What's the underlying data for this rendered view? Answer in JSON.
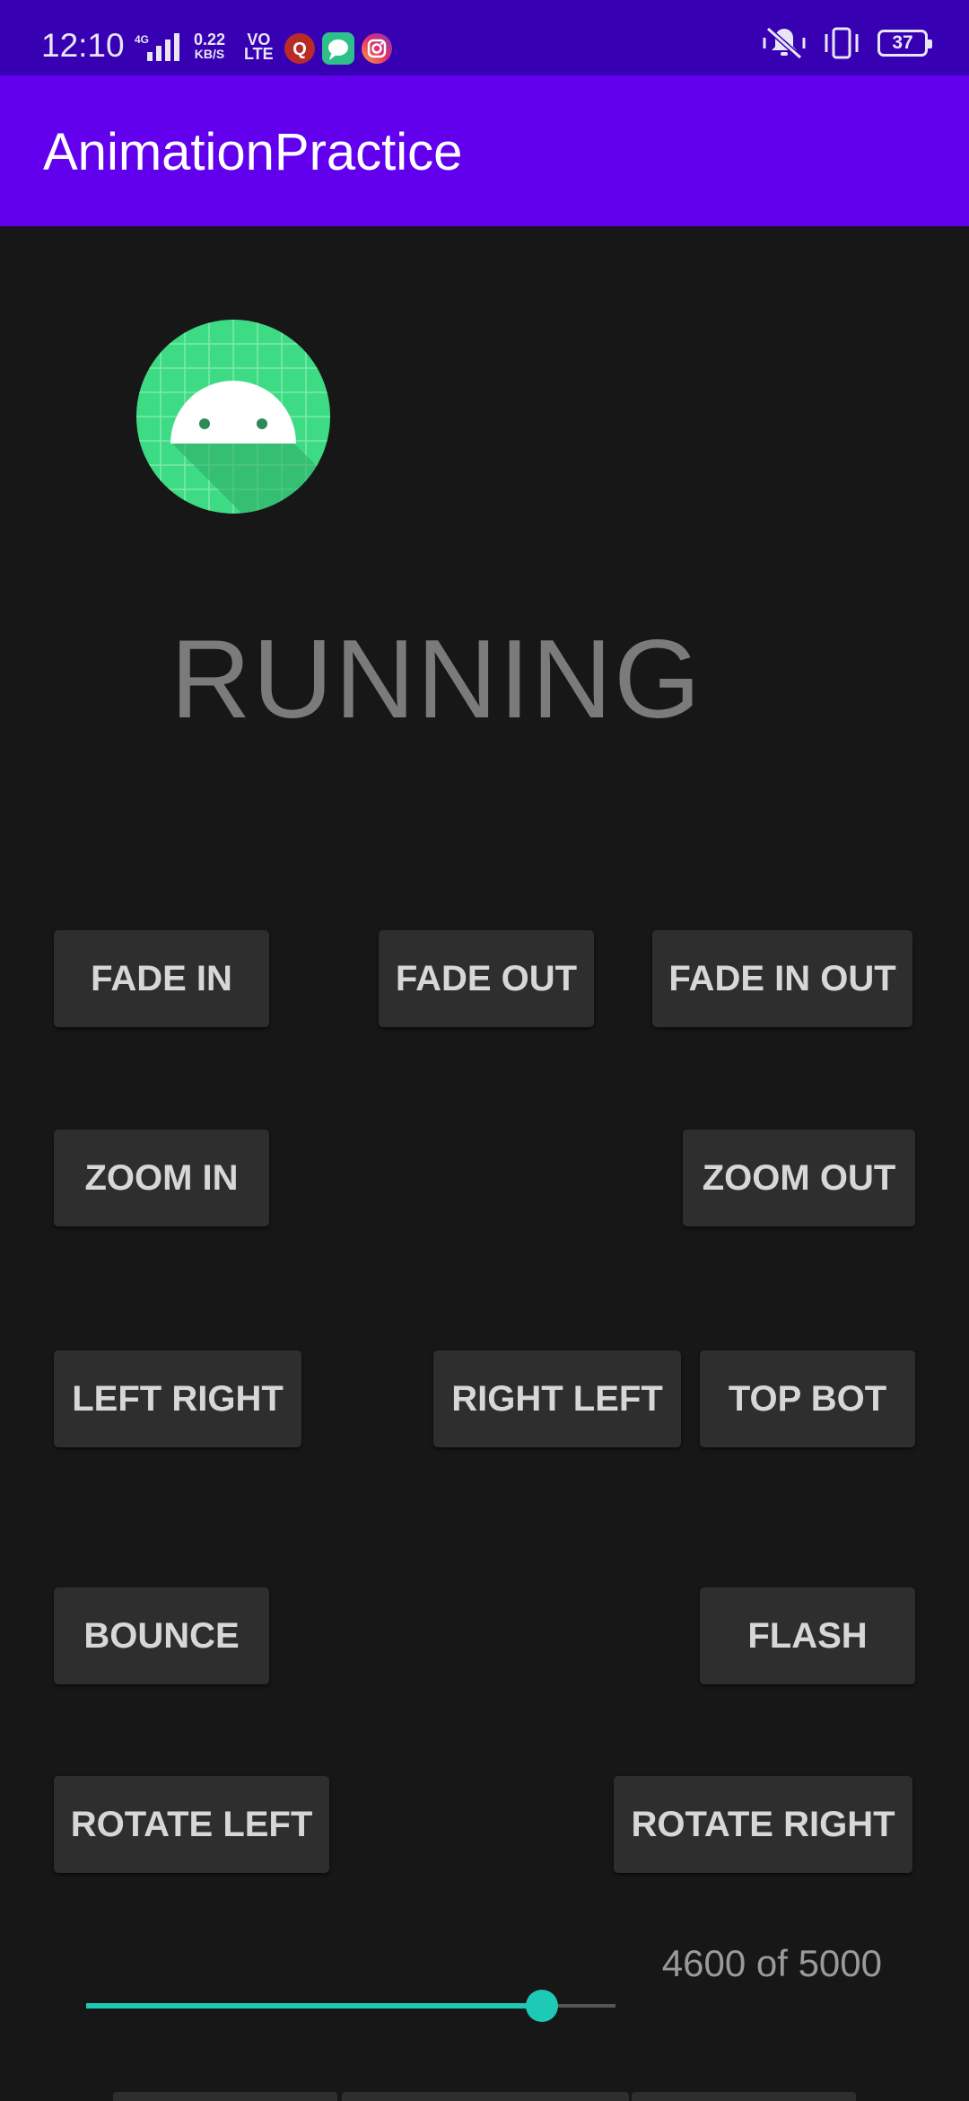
{
  "status_bar": {
    "time": "12:10",
    "network_type": "4G",
    "data_speed": "0.22",
    "data_speed_unit": "KB/S",
    "volte_top": "VO",
    "volte_bottom": "LTE",
    "battery": "37",
    "notification_icons": [
      "quora-app-icon",
      "chat-app-icon",
      "instagram-app-icon"
    ]
  },
  "app_bar": {
    "title": "AnimationPractice"
  },
  "main": {
    "status_text": "RUNNING",
    "buttons": {
      "fade_in": "FADE IN",
      "fade_out": "FADE OUT",
      "fade_in_out": "FADE IN OUT",
      "zoom_in": "ZOOM IN",
      "zoom_out": "ZOOM OUT",
      "left_right": "LEFT RIGHT",
      "right_left": "RIGHT LEFT",
      "top_bot": "TOP BOT",
      "bounce": "BOUNCE",
      "flash": "FLASH",
      "rotate_left": "ROTATE LEFT",
      "rotate_right": "ROTATE RIGHT"
    },
    "duration": {
      "counter_text": "4600 of 5000",
      "value": 4600,
      "max": 5000
    }
  },
  "colors": {
    "status_bar": "#3700b3",
    "app_bar": "#6200ee",
    "background": "#171717",
    "button": "#2e2e2e",
    "accent": "#1ec9b5",
    "android_green": "#3ddc84"
  }
}
